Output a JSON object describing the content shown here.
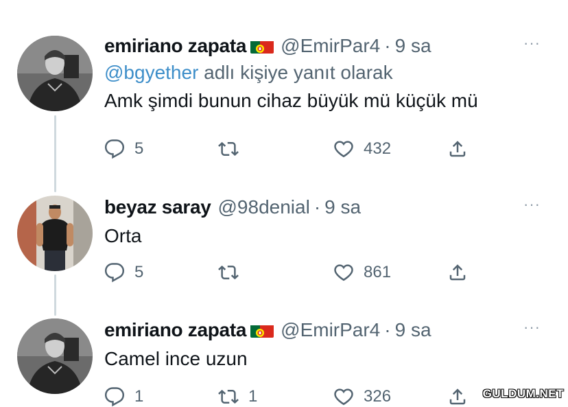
{
  "tweets": [
    {
      "name": "emiriano zapata",
      "flag": "portugal-flag",
      "handle": "@EmirPar4",
      "separator": "·",
      "time": "9 sa",
      "more": "···",
      "reply_mention": "@bgyether",
      "reply_suffix": "adlı kişiye yanıt olarak",
      "text": "Amk şimdi bunun cihaz büyük mü küçük mü",
      "replies": "5",
      "retweets": "",
      "likes": "432"
    },
    {
      "name": "beyaz saray",
      "handle": "@98denial",
      "separator": "·",
      "time": "9 sa",
      "more": "···",
      "text": "Orta",
      "replies": "5",
      "retweets": "",
      "likes": "861"
    },
    {
      "name": "emiriano zapata",
      "flag": "portugal-flag",
      "handle": "@EmirPar4",
      "separator": "·",
      "time": "9 sa",
      "more": "···",
      "text": "Camel ince uzun",
      "replies": "1",
      "retweets": "1",
      "likes": "326"
    }
  ],
  "watermark": "GULDUM.NET",
  "colors": {
    "mention": "#3d8ec9",
    "secondary_text": "#536471",
    "thread_line": "#cfd9de"
  }
}
